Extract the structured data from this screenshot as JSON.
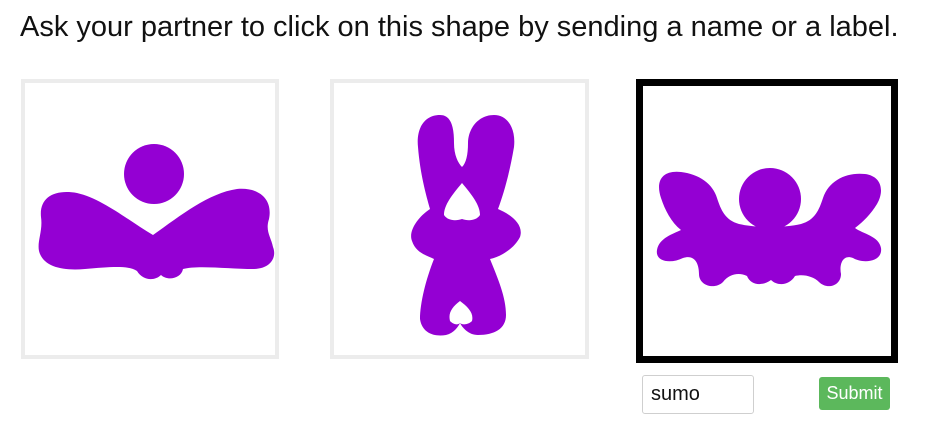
{
  "instruction": "Ask your partner to click on this shape by sending a name or a label.",
  "colors": {
    "shape_fill": "#9400d3",
    "selected_border": "#000000",
    "unselected_border": "#ececec",
    "submit_background": "#5cb85c"
  },
  "shapes": [
    {
      "icon": "winged-figure-with-head-icon",
      "selected": false
    },
    {
      "icon": "crossed-legs-figure-icon",
      "selected": false
    },
    {
      "icon": "sumo-figure-icon",
      "selected": true
    }
  ],
  "label_input": {
    "value": "sumo "
  },
  "submit_label": "Submit"
}
